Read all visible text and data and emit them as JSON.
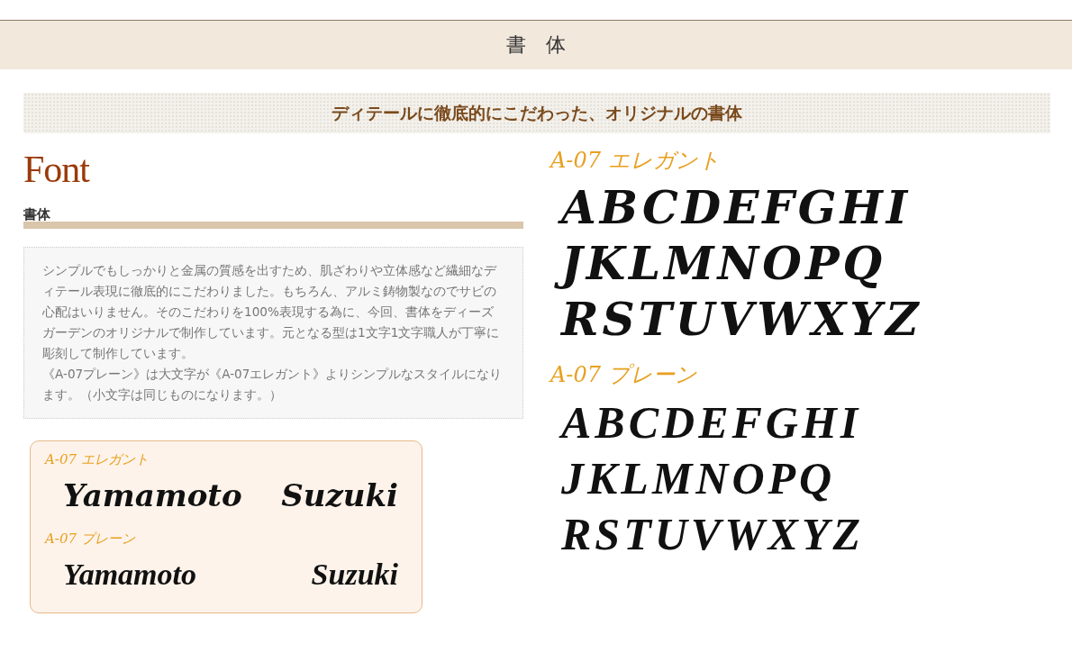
{
  "header": {
    "title": "書　体"
  },
  "banner": {
    "text": "ディテールに徹底的にこだわった、オリジナルの書体"
  },
  "intro": {
    "heading": "Font",
    "subheading": "書体",
    "description": [
      "シンプルでもしっかりと金属の質感を出すため、肌ざわりや立体感など繊細なディテール表現に徹底的にこだわりました。もちろん、アルミ鋳物製なのでサビの心配はいりません。そのこだわりを100%表現する為に、今回、書体をディーズガーデンのオリジナルで制作しています。元となる型は1文字1文字職人が丁寧に彫刻して制作しています。",
      "《A-07プレーン》は大文字が《A-07エレガント》よりシンプルなスタイルになります。（小文字は同じものになります。）"
    ]
  },
  "samples": [
    {
      "kind": "elegant",
      "label": "A-07 エレガント",
      "names": [
        "Yamamoto",
        "Suzuki"
      ]
    },
    {
      "kind": "plain",
      "label": "A-07 プレーン",
      "names": [
        "Yamamoto",
        "Suzuki"
      ]
    }
  ],
  "specimens": [
    {
      "kind": "elegant",
      "label": "A-07 エレガント",
      "lines": [
        "ABCDEFGHI",
        "JKLMNOPQ",
        "RSTUVWXYZ"
      ]
    },
    {
      "kind": "plain",
      "label": "A-07 プレーン",
      "lines": [
        "ABCDEFGHI",
        "JKLMNOPQ",
        "RSTUVWXYZ"
      ]
    }
  ]
}
